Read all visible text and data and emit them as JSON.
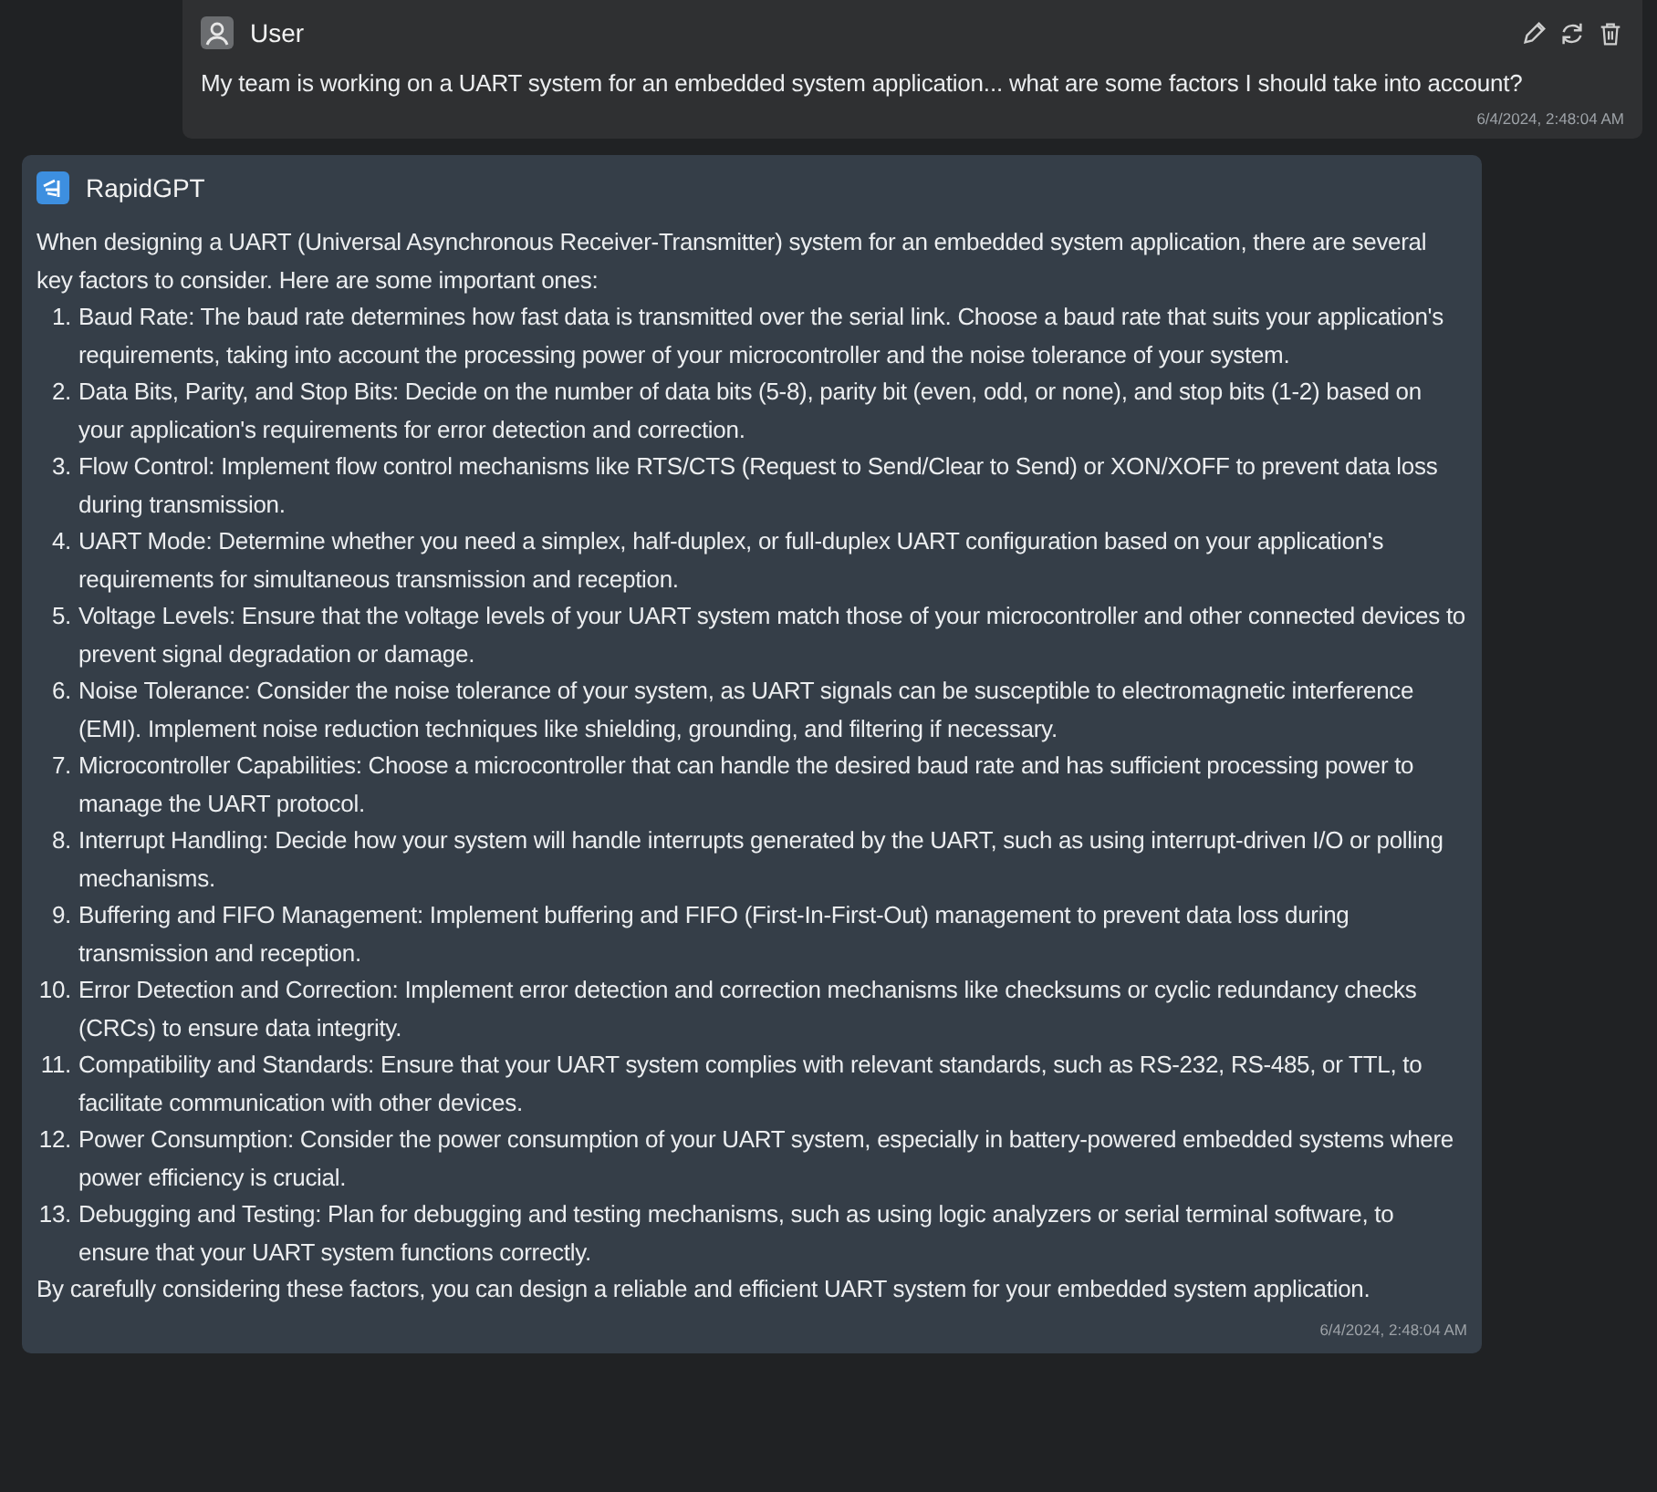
{
  "user_message": {
    "author": "User",
    "text": "My team is working on a UART system for an embedded system application... what are some factors I should take into account?",
    "timestamp": "6/4/2024, 2:48:04 AM"
  },
  "assistant_message": {
    "author": "RapidGPT",
    "intro": "When designing a UART (Universal Asynchronous Receiver-Transmitter) system for an embedded system application, there are several key factors to consider. Here are some important ones:",
    "items": [
      {
        "number": "1.",
        "text": "Baud Rate: The baud rate determines how fast data is transmitted over the serial link. Choose a baud rate that suits your application's requirements, taking into account the processing power of your microcontroller and the noise tolerance of your system."
      },
      {
        "number": "2.",
        "text": "Data Bits, Parity, and Stop Bits: Decide on the number of data bits (5-8), parity bit (even, odd, or none), and stop bits (1-2) based on your application's requirements for error detection and correction."
      },
      {
        "number": "3.",
        "text": "Flow Control: Implement flow control mechanisms like RTS/CTS (Request to Send/Clear to Send) or XON/XOFF to prevent data loss during transmission."
      },
      {
        "number": "4.",
        "text": "UART Mode: Determine whether you need a simplex, half-duplex, or full-duplex UART configuration based on your application's requirements for simultaneous transmission and reception."
      },
      {
        "number": "5.",
        "text": "Voltage Levels: Ensure that the voltage levels of your UART system match those of your microcontroller and other connected devices to prevent signal degradation or damage."
      },
      {
        "number": "6.",
        "text": "Noise Tolerance: Consider the noise tolerance of your system, as UART signals can be susceptible to electromagnetic interference (EMI). Implement noise reduction techniques like shielding, grounding, and filtering if necessary."
      },
      {
        "number": "7.",
        "text": "Microcontroller Capabilities: Choose a microcontroller that can handle the desired baud rate and has sufficient processing power to manage the UART protocol."
      },
      {
        "number": "8.",
        "text": "Interrupt Handling: Decide how your system will handle interrupts generated by the UART, such as using interrupt-driven I/O or polling mechanisms."
      },
      {
        "number": "9.",
        "text": "Buffering and FIFO Management: Implement buffering and FIFO (First-In-First-Out) management to prevent data loss during transmission and reception."
      },
      {
        "number": "10.",
        "text": "Error Detection and Correction: Implement error detection and correction mechanisms like checksums or cyclic redundancy checks (CRCs) to ensure data integrity."
      },
      {
        "number": "11.",
        "text": "Compatibility and Standards: Ensure that your UART system complies with relevant standards, such as RS-232, RS-485, or TTL, to facilitate communication with other devices."
      },
      {
        "number": "12.",
        "text": "Power Consumption: Consider the power consumption of your UART system, especially in battery-powered embedded systems where power efficiency is crucial."
      },
      {
        "number": "13.",
        "text": "Debugging and Testing: Plan for debugging and testing mechanisms, such as using logic analyzers or serial terminal software, to ensure that your UART system functions correctly."
      }
    ],
    "conclusion": "By carefully considering these factors, you can design a reliable and efficient UART system for your embedded system application.",
    "timestamp": "6/4/2024, 2:48:04 AM"
  }
}
